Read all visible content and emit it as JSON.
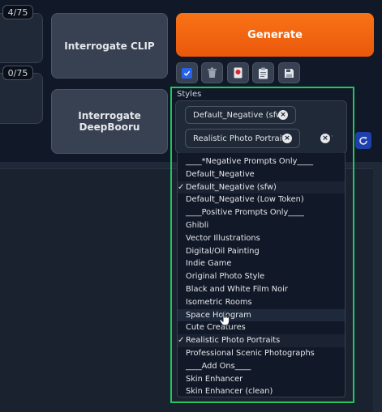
{
  "token_counters": {
    "positive": "4/75",
    "negative": "0/75"
  },
  "buttons": {
    "interrogate_clip": "Interrogate CLIP",
    "interrogate_deepbooru": "Interrogate DeepBooru",
    "generate": "Generate"
  },
  "tool_buttons": [
    {
      "icon": "checkbox-icon"
    },
    {
      "icon": "trash-icon"
    },
    {
      "icon": "red-card-icon"
    },
    {
      "icon": "clipboard-icon"
    },
    {
      "icon": "save-icon"
    }
  ],
  "styles": {
    "label": "Styles",
    "selected": [
      "Default_Negative (sfw)",
      "Realistic Photo Portraits"
    ],
    "options": [
      {
        "label": "____*Negative Prompts Only____",
        "checked": false
      },
      {
        "label": "Default_Negative",
        "checked": false
      },
      {
        "label": "Default_Negative (sfw)",
        "checked": true
      },
      {
        "label": "Default_Negative (Low Token)",
        "checked": false
      },
      {
        "label": "____Positive Prompts Only____",
        "checked": false
      },
      {
        "label": "Ghibli",
        "checked": false
      },
      {
        "label": "Vector Illustrations",
        "checked": false
      },
      {
        "label": "Digital/Oil Painting",
        "checked": false
      },
      {
        "label": "Indie Game",
        "checked": false
      },
      {
        "label": "Original Photo Style",
        "checked": false
      },
      {
        "label": "Black and White Film Noir",
        "checked": false
      },
      {
        "label": "Isometric Rooms",
        "checked": false
      },
      {
        "label": "Space Hologram",
        "checked": false
      },
      {
        "label": "Cute Creatures",
        "checked": false
      },
      {
        "label": "Realistic Photo Portraits",
        "checked": true
      },
      {
        "label": "Professional Scenic Photographs",
        "checked": false
      },
      {
        "label": "____Add Ons____",
        "checked": false
      },
      {
        "label": "Skin Enhancer",
        "checked": false
      },
      {
        "label": "Skin Enhancer (clean)",
        "checked": false
      }
    ]
  },
  "colors": {
    "generate": "#f97316",
    "highlight": "#22c55e"
  }
}
